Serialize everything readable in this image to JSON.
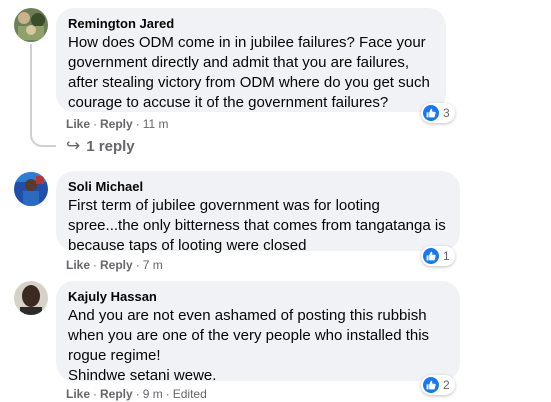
{
  "comments": [
    {
      "author": "Remington Jared",
      "text": "How does ODM come in in jubilee failures? Face your government directly and admit that you are failures, after stealing victory from ODM where do you get such courage to accuse it of the government failures?",
      "like_label": "Like",
      "reply_label": "Reply",
      "time": "11 m",
      "reaction_count": "3",
      "replies_label": "1 reply",
      "replies_arrow": "↪"
    },
    {
      "author": "Soli Michael",
      "text": "First term of jubilee government was for looting spree...the only bitterness that comes from tangatanga is because taps of looting were closed",
      "like_label": "Like",
      "reply_label": "Reply",
      "time": "7 m",
      "reaction_count": "1"
    },
    {
      "author": "Kajuly Hassan",
      "text_lines": [
        "And you are not even ashamed of posting this rubbish",
        "when you are one of the very people who installed this",
        "rogue regime!",
        "Shindwe setani wewe."
      ],
      "like_label": "Like",
      "reply_label": "Reply",
      "time": "9 m",
      "edited_label": "Edited",
      "reaction_count": "2"
    }
  ],
  "colors": {
    "bubble": "#f0f2f5",
    "meta": "#65676b",
    "like_blue": "#1877f2",
    "thread_line": "#ced0d4"
  },
  "icons": [
    "like-icon",
    "reply-arrow-icon"
  ]
}
